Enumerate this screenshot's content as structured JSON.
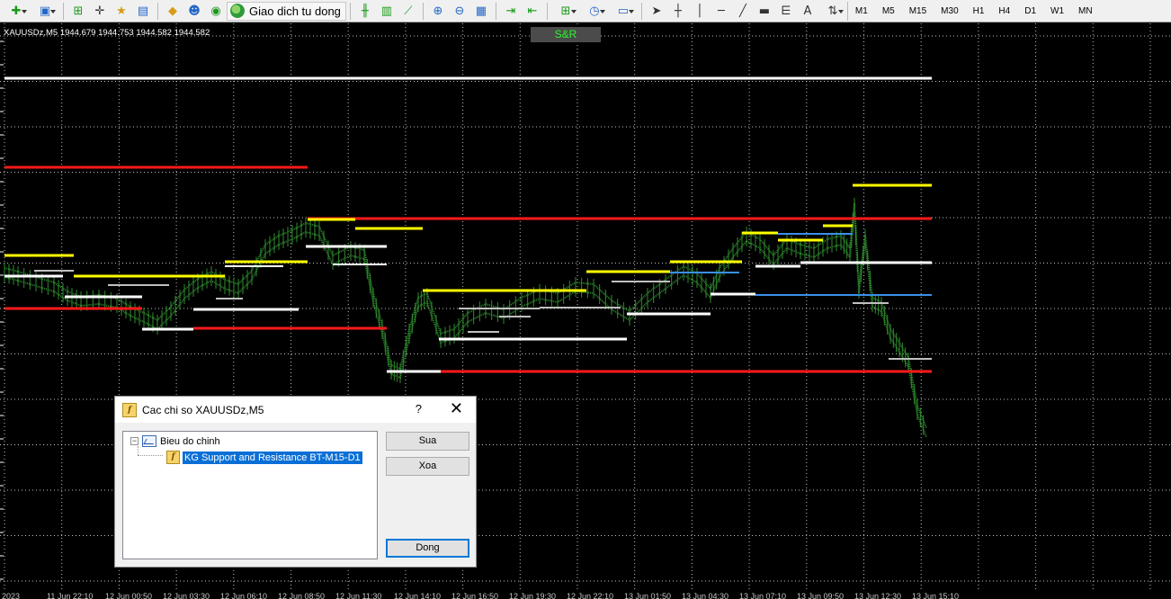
{
  "toolbar": {
    "autotrade_label": "Giao dich tu dong",
    "timeframes": [
      "M1",
      "M5",
      "M15",
      "M30",
      "H1",
      "H4",
      "D1",
      "W1",
      "MN"
    ]
  },
  "chart": {
    "title": "XAUUSDz,M5  1944.679 1944.753 1944.582 1944.582",
    "indicator_label": "S&R",
    "x_labels": [
      "2023",
      "11 Jun 22:10",
      "12 Jun 00:50",
      "12 Jun 03:30",
      "12 Jun 06:10",
      "12 Jun 08:50",
      "12 Jun 11:30",
      "12 Jun 14:10",
      "12 Jun 16:50",
      "12 Jun 19:30",
      "12 Jun 22:10",
      "13 Jun 01:50",
      "13 Jun 04:30",
      "13 Jun 07:10",
      "13 Jun 09:50",
      "13 Jun 12:30",
      "13 Jun 15:10"
    ],
    "colors": {
      "background": "#000000",
      "grid": "#ffffff",
      "price": "#2e8b2e",
      "resistance": "#ff1a1a",
      "support_strong": "#ffff00",
      "support": "#ffffff",
      "support_weak": "#c0c0c0",
      "level_blue": "#3a8fe8",
      "label_text": "#2ef22e"
    }
  },
  "dialog": {
    "title": "Cac chi so XAUUSDz,M5",
    "help": "?",
    "close": "✕",
    "tree": {
      "root_label": "Bieu do chinh",
      "expander": "−",
      "indicator_label": "KG Support and Resistance BT-M15-D1"
    },
    "buttons": {
      "edit": "Sua",
      "delete": "Xoa",
      "close": "Dong"
    }
  }
}
